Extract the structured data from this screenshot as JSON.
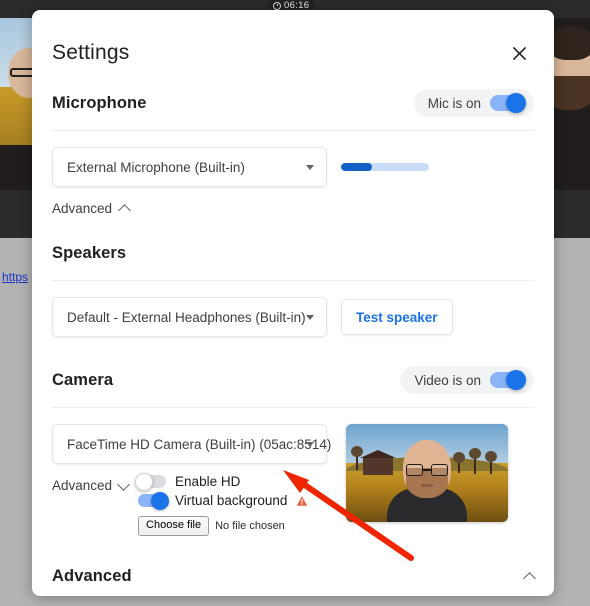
{
  "background": {
    "timer": {
      "label": "06:16",
      "icon": "clock-icon"
    },
    "link_text": "https"
  },
  "modal": {
    "title": "Settings",
    "close_icon": "close-icon",
    "sections": {
      "microphone": {
        "title": "Microphone",
        "toggle": {
          "label": "Mic is on",
          "state": "on"
        },
        "device": {
          "value": "External Microphone (Built-in)"
        },
        "level_meter": {
          "percent": 35,
          "fill_color": "#1361c4",
          "track_color": "#c9ddf8"
        },
        "advanced": {
          "label": "Advanced",
          "expanded": true,
          "chevron": "chevron-up-icon"
        }
      },
      "speakers": {
        "title": "Speakers",
        "device": {
          "value": "Default - External Headphones (Built-in)"
        },
        "test_button": "Test speaker"
      },
      "camera": {
        "title": "Camera",
        "toggle": {
          "label": "Video is on",
          "state": "on"
        },
        "device": {
          "value": "FaceTime HD Camera (Built-in) (05ac:8514)"
        },
        "advanced": {
          "label": "Advanced",
          "expanded": true,
          "chevron": "chevron-down-icon"
        },
        "options": [
          {
            "label": "Enable HD",
            "state": "off"
          },
          {
            "label": "Virtual background",
            "state": "on",
            "warning_icon": "warning-triangle-icon",
            "warning_color": "#e8633a"
          }
        ],
        "file_picker": {
          "button": "Choose file",
          "status": "No file chosen"
        },
        "preview_alt": "Camera preview with virtual background"
      },
      "advanced_bottom": {
        "title": "Advanced",
        "chevron": "chevron-up-icon"
      }
    }
  },
  "annotation": {
    "arrow_color": "#ef2400",
    "type": "pointer-arrow"
  }
}
